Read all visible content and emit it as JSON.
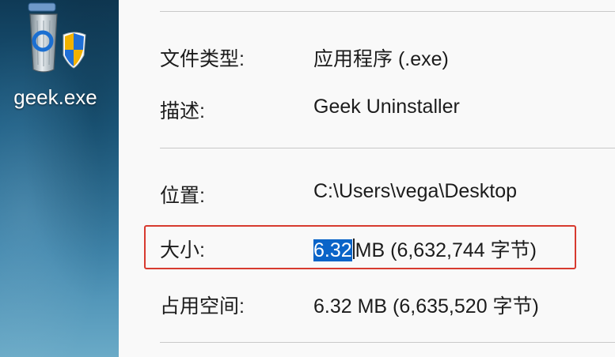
{
  "desktop": {
    "icon_label": "geek.exe",
    "icon": "recycle-bin-shield-icon"
  },
  "properties": {
    "file_type_label": "文件类型:",
    "file_type_value": "应用程序 (.exe)",
    "description_label": "描述:",
    "description_value": "Geek Uninstaller",
    "location_label": "位置:",
    "location_value": "C:\\Users\\vega\\Desktop",
    "size_label": "大小:",
    "size_selected": "6.32",
    "size_rest": "MB (6,632,744 字节)",
    "size_on_disk_label": "占用空间:",
    "size_on_disk_value": "6.32 MB (6,635,520 字节)"
  },
  "colors": {
    "highlight_border": "#d73a2f",
    "selection": "#0a64c8"
  }
}
